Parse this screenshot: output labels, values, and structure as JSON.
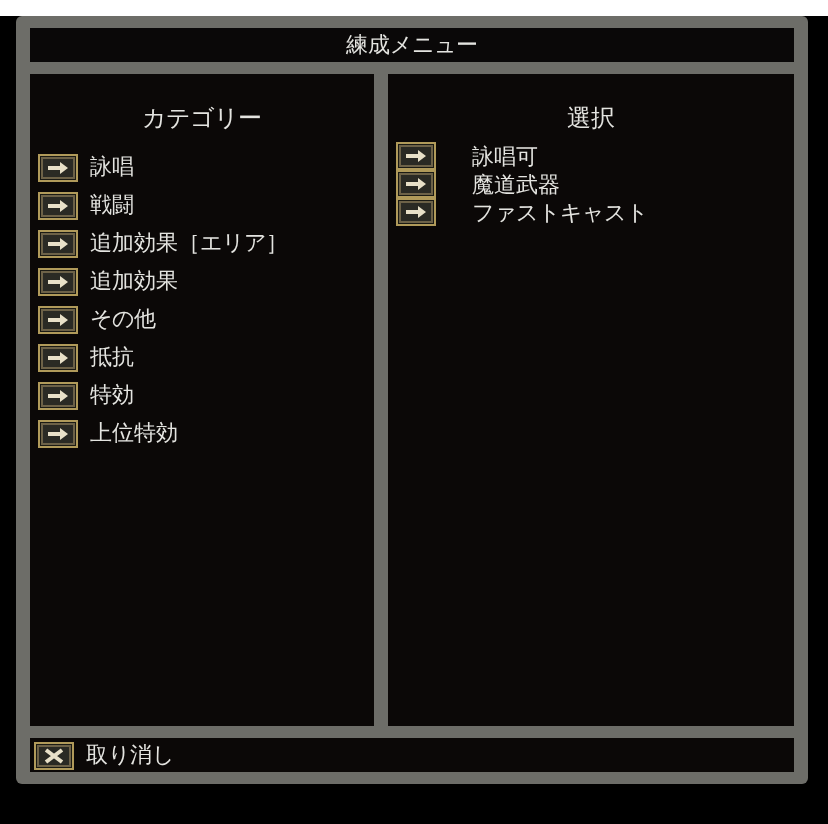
{
  "window": {
    "title": "練成メニュー"
  },
  "categories": {
    "heading": "カテゴリー",
    "items": [
      {
        "label": "詠唱"
      },
      {
        "label": "戦闘"
      },
      {
        "label": "追加効果［エリア］"
      },
      {
        "label": "追加効果"
      },
      {
        "label": "その他"
      },
      {
        "label": "抵抗"
      },
      {
        "label": "特効"
      },
      {
        "label": "上位特効"
      }
    ]
  },
  "selection": {
    "heading": "選択",
    "items": [
      {
        "label": "詠唱可"
      },
      {
        "label": "魔道武器"
      },
      {
        "label": "ファストキャスト"
      }
    ]
  },
  "cancel": {
    "label": "取り消し"
  }
}
